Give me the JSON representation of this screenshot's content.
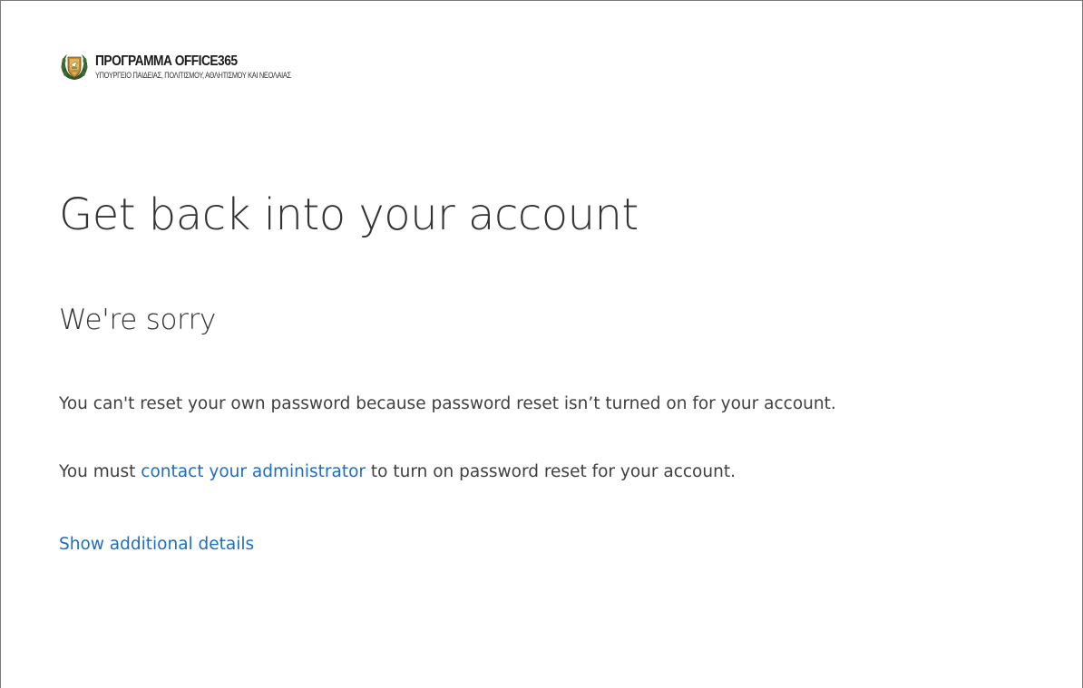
{
  "branding": {
    "title": "ΠΡΟΓΡΑΜΜΑ OFFICE365",
    "subtitle": "ΥΠΟΥΡΓΕΙΟ ΠΑΙΔΕΙΑΣ, ΠΟΛΙΤΙΣΜΟΥ, ΑΘΛΗΤΙΣΜΟΥ ΚΑΙ ΝΕΟΛΑΙΑΣ",
    "emblem_icon": "coat-of-arms-icon",
    "emblem_colors": {
      "wreath": "#2f5a2a",
      "shield": "#c28a2e"
    }
  },
  "main": {
    "title": "Get back into your account",
    "subtitle": "We're sorry",
    "message1": "You can't reset your own password because password reset isn’t turned on for your account.",
    "message2": {
      "before": "You must ",
      "link": "contact your administrator",
      "after": " to turn on password reset for your account."
    },
    "details_link": "Show additional details"
  },
  "colors": {
    "link": "#1f6dbf",
    "text": "#404040",
    "heading": "#333333"
  }
}
